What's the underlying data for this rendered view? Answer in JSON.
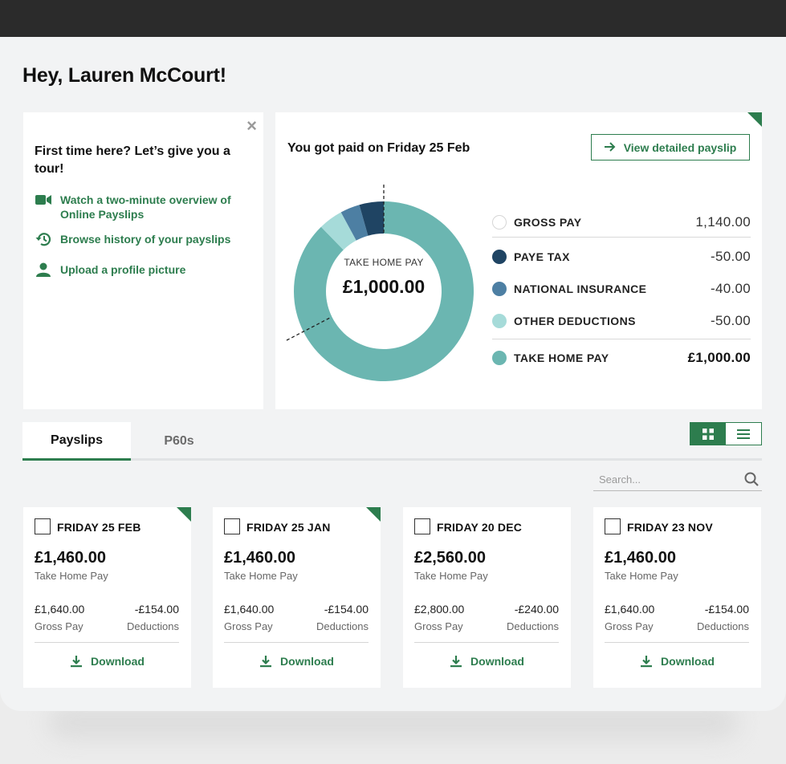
{
  "greeting": "Hey, Lauren McCourt!",
  "tour": {
    "title": "First time here? Let’s give you a tour!",
    "close": "×",
    "links": [
      {
        "icon": "video-camera-icon",
        "label": "Watch a two-minute overview of Online Payslips"
      },
      {
        "icon": "history-icon",
        "label": "Browse history of your payslips"
      },
      {
        "icon": "user-icon",
        "label": "Upload a profile picture"
      }
    ]
  },
  "payday": {
    "title": "You got paid on Friday 25 Feb",
    "button_label": "View detailed payslip",
    "center_label": "TAKE HOME PAY",
    "center_value": "£1,000.00",
    "legend": [
      {
        "label": "GROSS PAY",
        "amount": "1,140.00",
        "color": "#ffffff"
      },
      {
        "label": "PAYE TAX",
        "amount": "-50.00",
        "color": "#1f4463"
      },
      {
        "label": "NATIONAL INSURANCE",
        "amount": "-40.00",
        "color": "#4d7fa3"
      },
      {
        "label": "OTHER DEDUCTIONS",
        "amount": "-50.00",
        "color": "#a6dbd9"
      },
      {
        "label": "TAKE HOME PAY",
        "amount": "£1,000.00",
        "color": "#6bb6b1"
      }
    ]
  },
  "chart_data": {
    "type": "pie",
    "title": "",
    "categories": [
      "PAYE TAX",
      "NATIONAL INSURANCE",
      "OTHER DEDUCTIONS",
      "TAKE HOME PAY"
    ],
    "values": [
      50,
      40,
      50,
      1000
    ],
    "colors": [
      "#1f4463",
      "#4d7fa3",
      "#a6dbd9",
      "#6bb6b1"
    ]
  },
  "tabs": {
    "active": "Payslips",
    "inactive": "P60s"
  },
  "search": {
    "placeholder": "Search..."
  },
  "colors": {
    "accent": "#2d7d4e"
  },
  "payslips": [
    {
      "date": "FRIDAY 25 FEB",
      "take_home": "£1,460.00",
      "take_home_label": "Take Home Pay",
      "gross": "£1,640.00",
      "gross_label": "Gross Pay",
      "deductions": "-£154.00",
      "deductions_label": "Deductions",
      "download": "Download",
      "new": true
    },
    {
      "date": "FRIDAY 25 JAN",
      "take_home": "£1,460.00",
      "take_home_label": "Take Home Pay",
      "gross": "£1,640.00",
      "gross_label": "Gross Pay",
      "deductions": "-£154.00",
      "deductions_label": "Deductions",
      "download": "Download",
      "new": true
    },
    {
      "date": "FRIDAY 20 DEC",
      "take_home": "£2,560.00",
      "take_home_label": "Take Home Pay",
      "gross": "£2,800.00",
      "gross_label": "Gross Pay",
      "deductions": "-£240.00",
      "deductions_label": "Deductions",
      "download": "Download",
      "new": false
    },
    {
      "date": "FRIDAY 23 NOV",
      "take_home": "£1,460.00",
      "take_home_label": "Take Home Pay",
      "gross": "£1,640.00",
      "gross_label": "Gross Pay",
      "deductions": "-£154.00",
      "deductions_label": "Deductions",
      "download": "Download",
      "new": false
    }
  ]
}
